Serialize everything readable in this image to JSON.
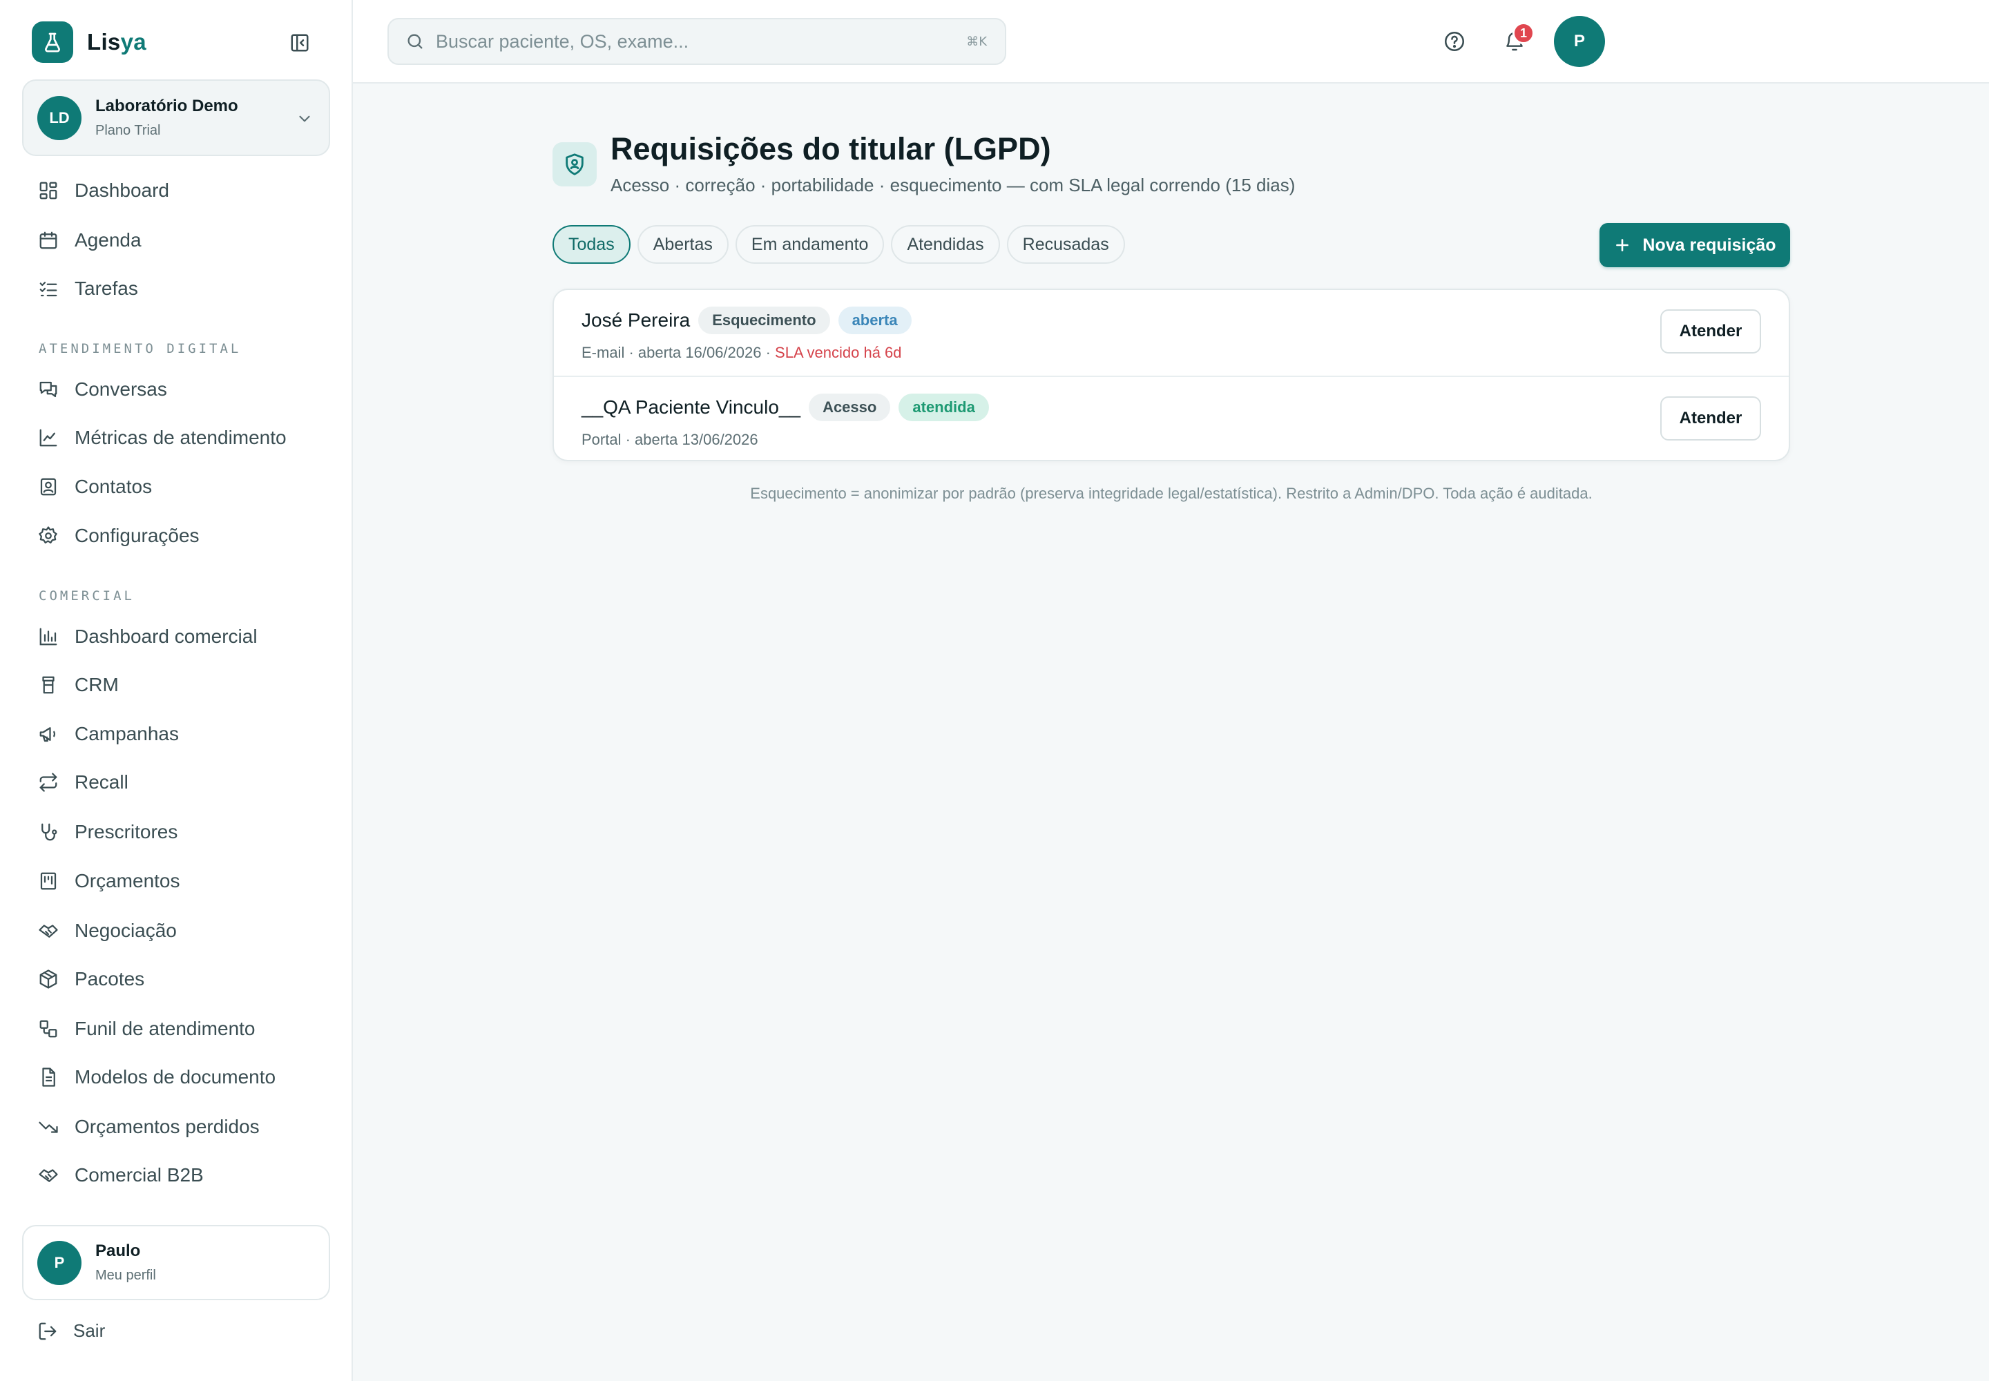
{
  "brand": {
    "name_a": "Lis",
    "name_b": "ya"
  },
  "org": {
    "initials": "LD",
    "name": "Laboratório Demo",
    "plan": "Plano Trial"
  },
  "nav_main": [
    {
      "label": "Dashboard",
      "icon": "dashboard-icon"
    },
    {
      "label": "Agenda",
      "icon": "calendar-icon"
    },
    {
      "label": "Tarefas",
      "icon": "checklist-icon"
    }
  ],
  "section_digital": "Atendimento digital",
  "nav_digital": [
    {
      "label": "Conversas",
      "icon": "chat-icon"
    },
    {
      "label": "Métricas de atendimento",
      "icon": "line-chart-icon"
    },
    {
      "label": "Contatos",
      "icon": "contact-icon"
    },
    {
      "label": "Configurações",
      "icon": "gear-icon"
    }
  ],
  "section_comercial": "Comercial",
  "nav_comercial": [
    {
      "label": "Dashboard comercial",
      "icon": "bar-chart-icon"
    },
    {
      "label": "CRM",
      "icon": "crm-icon"
    },
    {
      "label": "Campanhas",
      "icon": "megaphone-icon"
    },
    {
      "label": "Recall",
      "icon": "repeat-icon"
    },
    {
      "label": "Prescritores",
      "icon": "stethoscope-icon"
    },
    {
      "label": "Orçamentos",
      "icon": "receipt-icon"
    },
    {
      "label": "Negociação",
      "icon": "handshake-icon"
    },
    {
      "label": "Pacotes",
      "icon": "package-icon"
    },
    {
      "label": "Funil de atendimento",
      "icon": "workflow-icon"
    },
    {
      "label": "Modelos de documento",
      "icon": "document-icon"
    },
    {
      "label": "Orçamentos perdidos",
      "icon": "trending-down-icon"
    },
    {
      "label": "Comercial B2B",
      "icon": "handshake-icon"
    }
  ],
  "user": {
    "initial": "P",
    "name": "Paulo",
    "sub": "Meu perfil"
  },
  "logout_label": "Sair",
  "search": {
    "placeholder": "Buscar paciente, OS, exame...",
    "shortcut": "⌘K"
  },
  "notifications_count": "1",
  "top_avatar_initial": "P",
  "page": {
    "title": "Requisições do titular (LGPD)",
    "subtitle": "Acesso · correção · portabilidade · esquecimento — com SLA legal correndo (15 dias)"
  },
  "filters": [
    "Todas",
    "Abertas",
    "Em andamento",
    "Atendidas",
    "Recusadas"
  ],
  "active_filter": "Todas",
  "new_button_label": "Nova requisição",
  "requests": [
    {
      "name": "José Pereira",
      "type": "Esquecimento",
      "status": "aberta",
      "meta": "E-mail · aberta 16/06/2026 · ",
      "sla": "SLA vencido há 6d",
      "action": "Atender"
    },
    {
      "name": "__QA Paciente Vinculo__",
      "type": "Acesso",
      "status": "atendida",
      "meta": "Portal · aberta 13/06/2026",
      "sla": "",
      "action": "Atender"
    }
  ],
  "footnote": "Esquecimento = anonimizar por padrão (preserva integridade legal/estatística). Restrito a Admin/DPO. Toda ação é auditada.",
  "colors": {
    "accent": "#0f7a76",
    "danger": "#d5434b",
    "info": "#3b86b8",
    "success": "#1e9a73"
  }
}
